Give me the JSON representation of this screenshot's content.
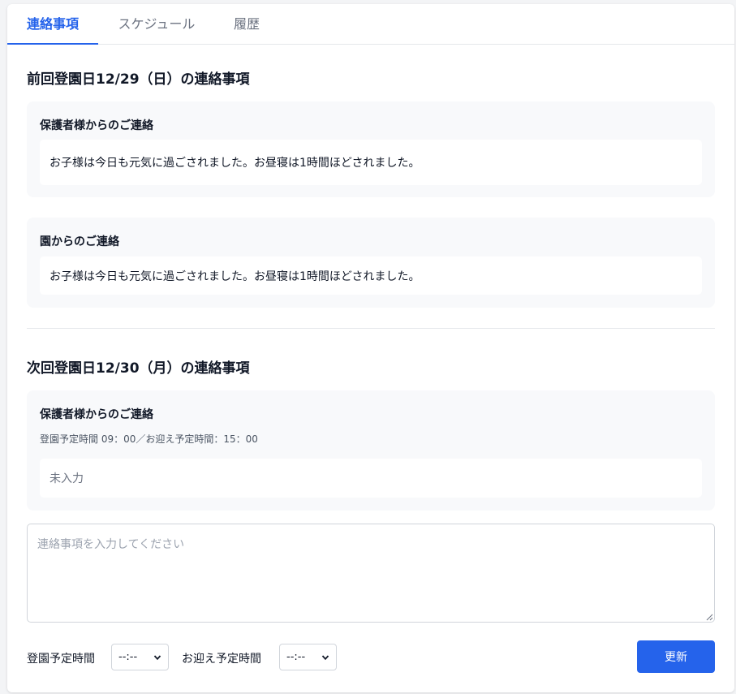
{
  "tabs": [
    {
      "label": "連絡事項",
      "active": true
    },
    {
      "label": "スケジュール",
      "active": false
    },
    {
      "label": "履歴",
      "active": false
    }
  ],
  "previous": {
    "title": "前回登園日12/29（日）の連絡事項",
    "parent_contact": {
      "title": "保護者様からのご連絡",
      "message": "お子様は今日も元気に過ごされました。お昼寝は1時間ほどされました。"
    },
    "school_contact": {
      "title": "園からのご連絡",
      "message": "お子様は今日も元気に過ごされました。お昼寝は1時間ほどされました。"
    }
  },
  "next": {
    "title": "次回登園日12/30（月）の連絡事項",
    "parent_contact": {
      "title": "保護者様からのご連絡",
      "schedule_text": "登園予定時間 09：00／お迎え予定時間：15：00",
      "message": "未入力"
    }
  },
  "form": {
    "textarea_placeholder": "連絡事項を入力してください",
    "arrival_label": "登園予定時間",
    "arrival_value": "--:--",
    "pickup_label": "お迎え予定時間",
    "pickup_value": "--:--",
    "submit_label": "更新"
  },
  "colors": {
    "accent": "#2563eb",
    "panel_bg": "#f8f9fb"
  }
}
